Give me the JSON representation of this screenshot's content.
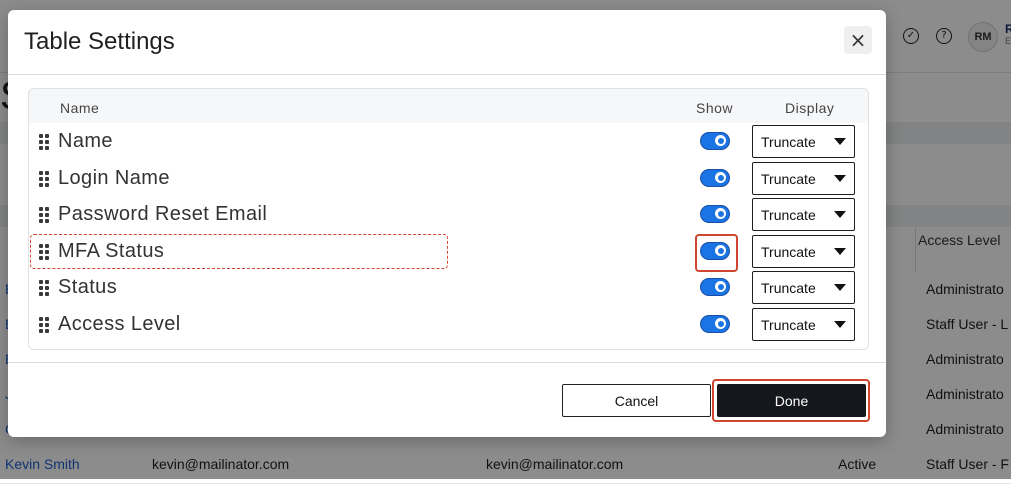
{
  "background": {
    "page_title": "S",
    "user_initials": "RM",
    "user_name": "R",
    "user_sub": "E",
    "access_level_header": "Access Level",
    "side_fragment": "g",
    "rows": [
      {
        "name": "E",
        "access": "Administrato"
      },
      {
        "name": "E",
        "access": "Staff User - L"
      },
      {
        "name": "E",
        "access": "Administrato"
      },
      {
        "name": "J",
        "access": "Administrato"
      },
      {
        "name": "C",
        "access": "Administrato"
      },
      {
        "name": "Kevin Smith",
        "login": "kevin@mailinator.com",
        "email": "kevin@mailinator.com",
        "status": "Active",
        "access": "Staff User - F"
      }
    ]
  },
  "modal": {
    "title": "Table Settings",
    "close_symbol": "×",
    "headers": {
      "name": "Name",
      "show": "Show",
      "display": "Display"
    },
    "rows": [
      {
        "label": "Name",
        "show": true,
        "display": "Truncate"
      },
      {
        "label": "Login Name",
        "show": true,
        "display": "Truncate"
      },
      {
        "label": "Password Reset Email",
        "show": true,
        "display": "Truncate"
      },
      {
        "label": "MFA Status",
        "show": true,
        "display": "Truncate"
      },
      {
        "label": "Status",
        "show": true,
        "display": "Truncate"
      },
      {
        "label": "Access Level",
        "show": true,
        "display": "Truncate"
      }
    ],
    "cancel_label": "Cancel",
    "done_label": "Done"
  },
  "colors": {
    "toggle_on": "#1b74e4",
    "highlight": "#d0462f",
    "primary_button": "#15171c",
    "link": "#1f5fd1"
  }
}
